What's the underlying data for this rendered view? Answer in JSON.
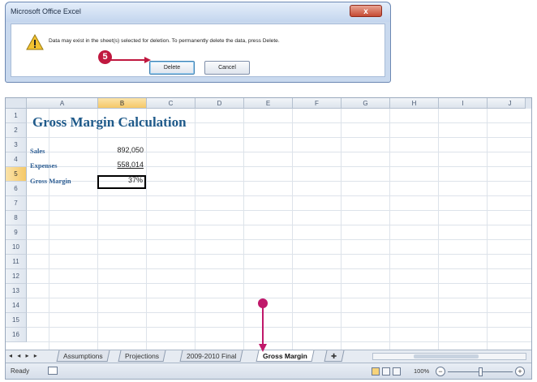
{
  "dialog": {
    "title": "Microsoft Office Excel",
    "close_label": "x",
    "message": "Data may exist in the sheet(s) selected for deletion. To permanently delete the data, press Delete.",
    "delete_label": "Delete",
    "cancel_label": "Cancel",
    "step_label": "5",
    "icon": "warning-icon"
  },
  "excel": {
    "columns": [
      "A",
      "B",
      "C",
      "D",
      "E",
      "F",
      "G",
      "H",
      "I",
      "J"
    ],
    "active_column": "B",
    "rows": [
      "1",
      "2",
      "3",
      "4",
      "5",
      "6",
      "7",
      "8",
      "9",
      "10",
      "11",
      "12",
      "13",
      "14",
      "15",
      "16"
    ],
    "active_row": "5",
    "title": "Gross Margin Calculation",
    "sales_label": "Sales",
    "sales_value": "892,050",
    "expenses_label": "Expenses",
    "expenses_value": "558,014",
    "gross_margin_label": "Gross Margin",
    "gross_margin_value": "37%",
    "tabs": [
      "Assumptions",
      "Projections",
      "2009-2010 Final",
      "Gross Margin"
    ],
    "active_tab": "Gross Margin",
    "status": "Ready",
    "zoom": "100%"
  },
  "colors": {
    "dialog_bg": "#c9d9ee",
    "title_text": "#1f5a8a",
    "step_badge": "#c0183f",
    "active_header": "#f5c868"
  }
}
